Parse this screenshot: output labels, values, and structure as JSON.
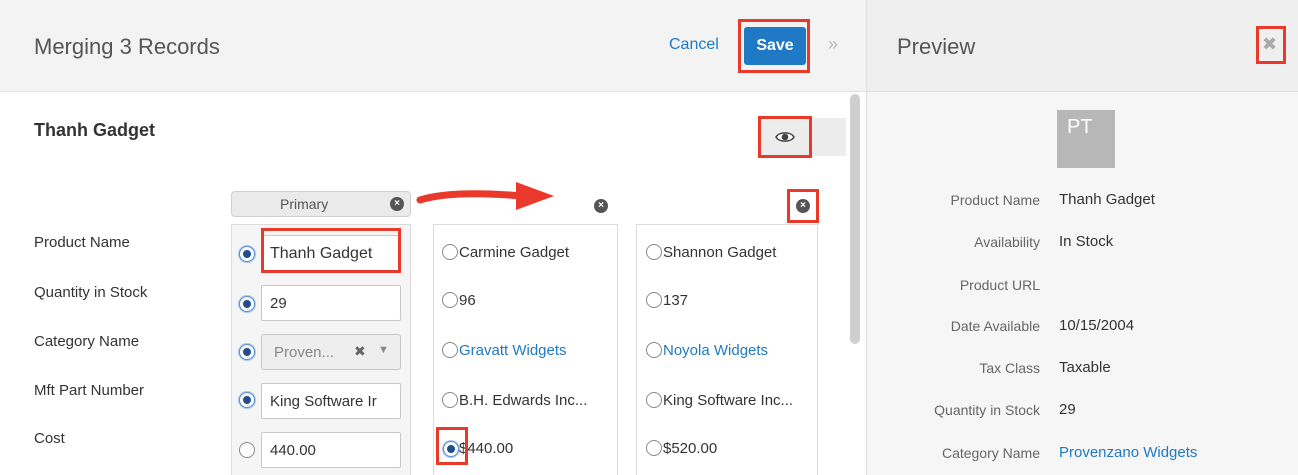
{
  "merge": {
    "title": "Merging 3 Records",
    "cancel_label": "Cancel",
    "save_label": "Save",
    "collapse_icon": "double-chevron-right-icon",
    "record_name": "Thanh Gadget",
    "preview_icon": "eye-icon",
    "primary_label": "Primary"
  },
  "fields": [
    {
      "label": "Product Name"
    },
    {
      "label": "Quantity in Stock"
    },
    {
      "label": "Category Name"
    },
    {
      "label": "Mft Part Number"
    },
    {
      "label": "Cost"
    }
  ],
  "primary_record": {
    "product_name": "Thanh Gadget",
    "quantity": "29",
    "category": "Proven...",
    "mft_part": "King Software Ir",
    "cost": "440.00"
  },
  "record2": {
    "product_name": "Carmine Gadget",
    "quantity": "96",
    "category": "Gravatt Widgets",
    "mft_part": "B.H. Edwards Inc...",
    "cost": "$440.00"
  },
  "record3": {
    "product_name": "Shannon Gadget",
    "quantity": "137",
    "category": "Noyola Widgets",
    "mft_part": "King Software Inc...",
    "cost": "$520.00"
  },
  "preview": {
    "title": "Preview",
    "close_icon": "close-icon",
    "avatar_initials": "PT",
    "rows": [
      {
        "label": "Product Name",
        "value": "Thanh Gadget"
      },
      {
        "label": "Availability",
        "value": "In Stock"
      },
      {
        "label": "Product URL",
        "value": ""
      },
      {
        "label": "Date Available",
        "value": "10/15/2004"
      },
      {
        "label": "Tax Class",
        "value": "Taxable"
      },
      {
        "label": "Quantity in Stock",
        "value": "29"
      },
      {
        "label": "Category Name",
        "value": "Provenzano Widgets"
      }
    ]
  },
  "colors": {
    "accent": "#1f79c4",
    "highlight": "#e8392a"
  }
}
